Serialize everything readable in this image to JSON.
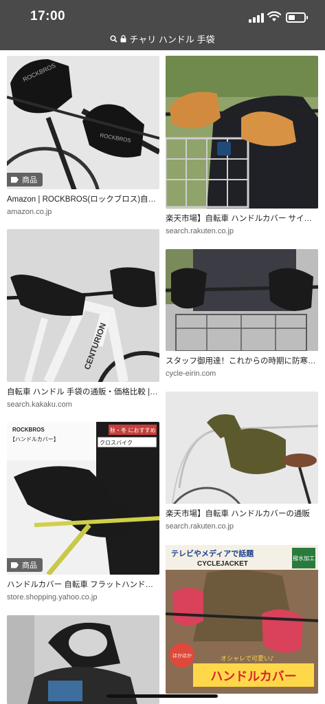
{
  "status": {
    "time": "17:00"
  },
  "browser": {
    "query": "チャリ ハンドル 手袋"
  },
  "results": [
    {
      "title": "Amazon | ROCKBROS(ロックブロス)自転車ハンドルカバー",
      "source": "amazon.co.jp",
      "badge": "商品"
    },
    {
      "title": "楽天市場】自転車 ハンドルカバー サイクル",
      "source": "search.rakuten.co.jp",
      "badge": ""
    },
    {
      "title": "自転車 ハンドル 手袋の通販・価格比較 | 価格.com",
      "source": "search.kakaku.com",
      "badge": ""
    },
    {
      "title": "スタッフ御用達！これからの時期に防寒グッズ",
      "source": "cycle-eirin.com",
      "badge": ""
    },
    {
      "title": "ハンドルカバー 自転車 フラットハンドル用",
      "source": "store.shopping.yahoo.co.jp",
      "badge": "商品"
    },
    {
      "title": "楽天市場】自転車 ハンドルカバーの通販",
      "source": "search.rakuten.co.jp",
      "badge": ""
    }
  ],
  "image_text": {
    "rockbros_logo": "ROCKBROS",
    "rockbros_sub": "【ハンドルカバー】",
    "tag_cross": "クロスバイク",
    "tag_autumn": "秋・冬 におすすめ",
    "tag_cross_sub": "におすすめ",
    "ad_headline": "テレビやメディアで話題",
    "ad_product": "CYCLEJACKET",
    "ad_waterproof": "撥水加工",
    "ad_warm": "ほかほか",
    "ad_tagline": "オシャレで可愛い♪",
    "ad_name": "ハンドルカバー",
    "centurion": "CENTURION"
  }
}
